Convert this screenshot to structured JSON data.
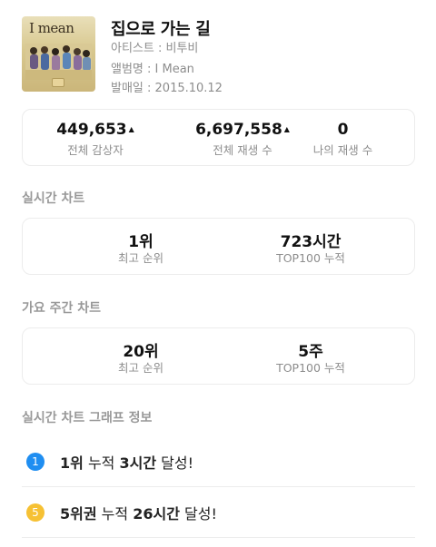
{
  "album": {
    "cover_text": "I mean",
    "title": "집으로 가는 길",
    "artist": "아티스트 : 비투비",
    "album_name": "앨범명 : I Mean",
    "release": "발매일 : 2015.10.12"
  },
  "stats": {
    "total_listeners": {
      "value": "449,653",
      "label": "전체 감상자",
      "arrow": "▲"
    },
    "total_plays": {
      "value": "6,697,558",
      "label": "전체 재생 수",
      "arrow": "▲"
    },
    "my_plays": {
      "value": "0",
      "label": "나의 재생 수"
    }
  },
  "realtime_chart": {
    "title": "실시간 차트",
    "best_rank": {
      "value": "1위",
      "label": "최고 순위"
    },
    "top100": {
      "value": "723시간",
      "label": "TOP100 누적"
    }
  },
  "weekly_chart": {
    "title": "가요 주간 차트",
    "best_rank": {
      "value": "20위",
      "label": "최고 순위"
    },
    "top100": {
      "value": "5주",
      "label": "TOP100 누적"
    }
  },
  "graph_info": {
    "title": "실시간 차트 그래프 정보",
    "rows": [
      {
        "badge": "1",
        "rank": "1위",
        "middle": " 누적 ",
        "duration": "3시간",
        "suffix": " 달성!",
        "color": "#1f8ef1"
      },
      {
        "badge": "5",
        "rank": "5위권",
        "middle": " 누적 ",
        "duration": "26시간",
        "suffix": " 달성!",
        "color": "#f6c134"
      }
    ]
  }
}
